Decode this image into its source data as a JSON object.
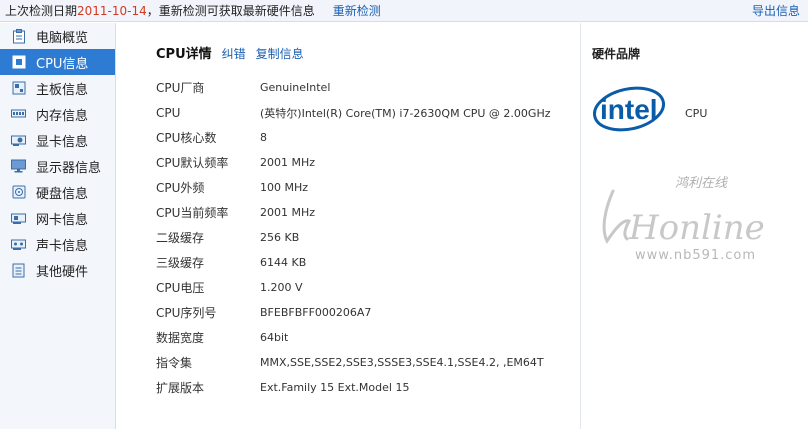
{
  "topbar": {
    "prefix": "上次检测日期",
    "date": "2011-10-14",
    "suffix": "，重新检测可获取最新硬件信息",
    "recheck_label": "重新检测",
    "export_label": "导出信息"
  },
  "sidebar": {
    "items": [
      {
        "label": "电脑概览",
        "icon": "clipboard-icon"
      },
      {
        "label": "CPU信息",
        "icon": "cpu-icon",
        "active": true
      },
      {
        "label": "主板信息",
        "icon": "motherboard-icon"
      },
      {
        "label": "内存信息",
        "icon": "memory-icon"
      },
      {
        "label": "显卡信息",
        "icon": "graphics-card-icon"
      },
      {
        "label": "显示器信息",
        "icon": "monitor-icon"
      },
      {
        "label": "硬盘信息",
        "icon": "hard-disk-icon"
      },
      {
        "label": "网卡信息",
        "icon": "network-card-icon"
      },
      {
        "label": "声卡信息",
        "icon": "sound-card-icon"
      },
      {
        "label": "其他硬件",
        "icon": "other-hardware-icon"
      }
    ]
  },
  "main": {
    "title": "CPU详情",
    "report_error_label": "纠错",
    "copy_label": "复制信息",
    "rows": [
      {
        "key": "CPU厂商",
        "value": "GenuineIntel"
      },
      {
        "key": "CPU",
        "value": "(英特尔)Intel(R) Core(TM) i7-2630QM CPU @ 2.00GHz"
      },
      {
        "key": "CPU核心数",
        "value": "8"
      },
      {
        "key": "CPU默认频率",
        "value": "2001 MHz"
      },
      {
        "key": "CPU外频",
        "value": "100 MHz"
      },
      {
        "key": "CPU当前频率",
        "value": "2001 MHz"
      },
      {
        "key": "二级缓存",
        "value": "256 KB"
      },
      {
        "key": "三级缓存",
        "value": "6144 KB"
      },
      {
        "key": "CPU电压",
        "value": "1.200 V"
      },
      {
        "key": "CPU序列号",
        "value": "BFEBFBFF000206A7"
      },
      {
        "key": "数据宽度",
        "value": "64bit"
      },
      {
        "key": "指令集",
        "value": "MMX,SSE,SSE2,SSE3,SSSE3,SSE4.1,SSE4.2, ,EM64T"
      },
      {
        "key": "扩展版本",
        "value": "Ext.Family 15  Ext.Model 15"
      }
    ]
  },
  "brand": {
    "title": "硬件品牌",
    "logo_text": "intel",
    "cpu_label": "CPU",
    "watermark_text": "Honline",
    "watermark_url": "www.nb591.com",
    "watermark_cn": "鸿利在线"
  },
  "colors": {
    "accent": "#2e7bd3",
    "link": "#1a5fb4",
    "date": "#d23a1f",
    "intel_blue": "#0a5ca8"
  }
}
